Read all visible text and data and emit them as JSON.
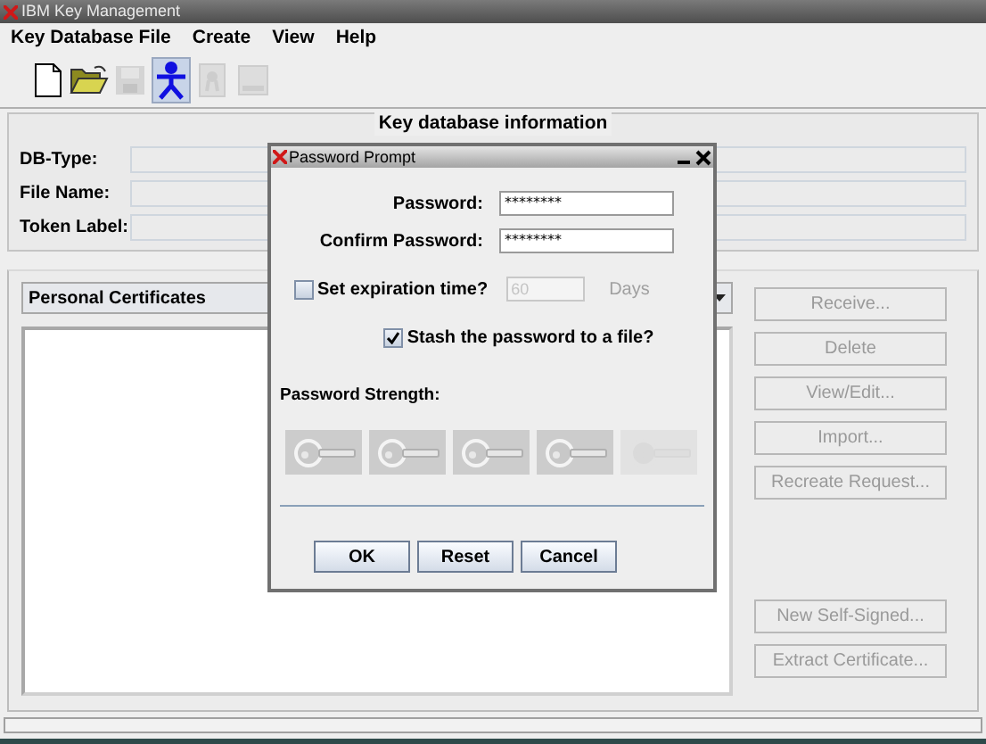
{
  "window": {
    "title": "IBM Key Management"
  },
  "menu": [
    {
      "label": "Key Database File"
    },
    {
      "label": "Create"
    },
    {
      "label": "View"
    },
    {
      "label": "Help"
    }
  ],
  "toolbar": [
    {
      "kind": "new",
      "disabled": false,
      "selected": false
    },
    {
      "kind": "open",
      "disabled": false,
      "selected": false
    },
    {
      "kind": "save",
      "disabled": true,
      "selected": false
    },
    {
      "kind": "person",
      "disabled": false,
      "selected": true
    },
    {
      "kind": "certificate",
      "disabled": true,
      "selected": false
    },
    {
      "kind": "card",
      "disabled": true,
      "selected": false
    }
  ],
  "info_panel": {
    "title": "Key database information",
    "fields": [
      {
        "label": "DB-Type:"
      },
      {
        "label": "File Name:"
      },
      {
        "label": "Token Label:"
      }
    ]
  },
  "certificates": {
    "dropdown": "Personal Certificates",
    "buttons_top": [
      {
        "label": "Receive...",
        "disabled": true
      },
      {
        "label": "Delete",
        "disabled": true
      },
      {
        "label": "View/Edit...",
        "disabled": true
      },
      {
        "label": "Import...",
        "disabled": true
      },
      {
        "label": "Recreate Request...",
        "disabled": true
      }
    ],
    "buttons_bottom": [
      {
        "label": "New Self-Signed...",
        "disabled": true
      },
      {
        "label": "Extract Certificate...",
        "disabled": true
      }
    ]
  },
  "dialog": {
    "title": "Password Prompt",
    "password": {
      "label": "Password:",
      "value": "********"
    },
    "confirm": {
      "label": "Confirm Password:",
      "value": "********"
    },
    "expiration": {
      "label": "Set expiration time?",
      "checked": false,
      "value": "60",
      "unit": "Days",
      "disabled": true
    },
    "stash": {
      "label": "Stash the password to a file?",
      "checked": true
    },
    "strength": {
      "label": "Password Strength:",
      "keys": [
        {
          "on": true
        },
        {
          "on": true
        },
        {
          "on": true
        },
        {
          "on": true
        },
        {
          "on": false
        }
      ]
    },
    "buttons": [
      {
        "label": "OK"
      },
      {
        "label": "Reset"
      },
      {
        "label": "Cancel"
      }
    ]
  }
}
